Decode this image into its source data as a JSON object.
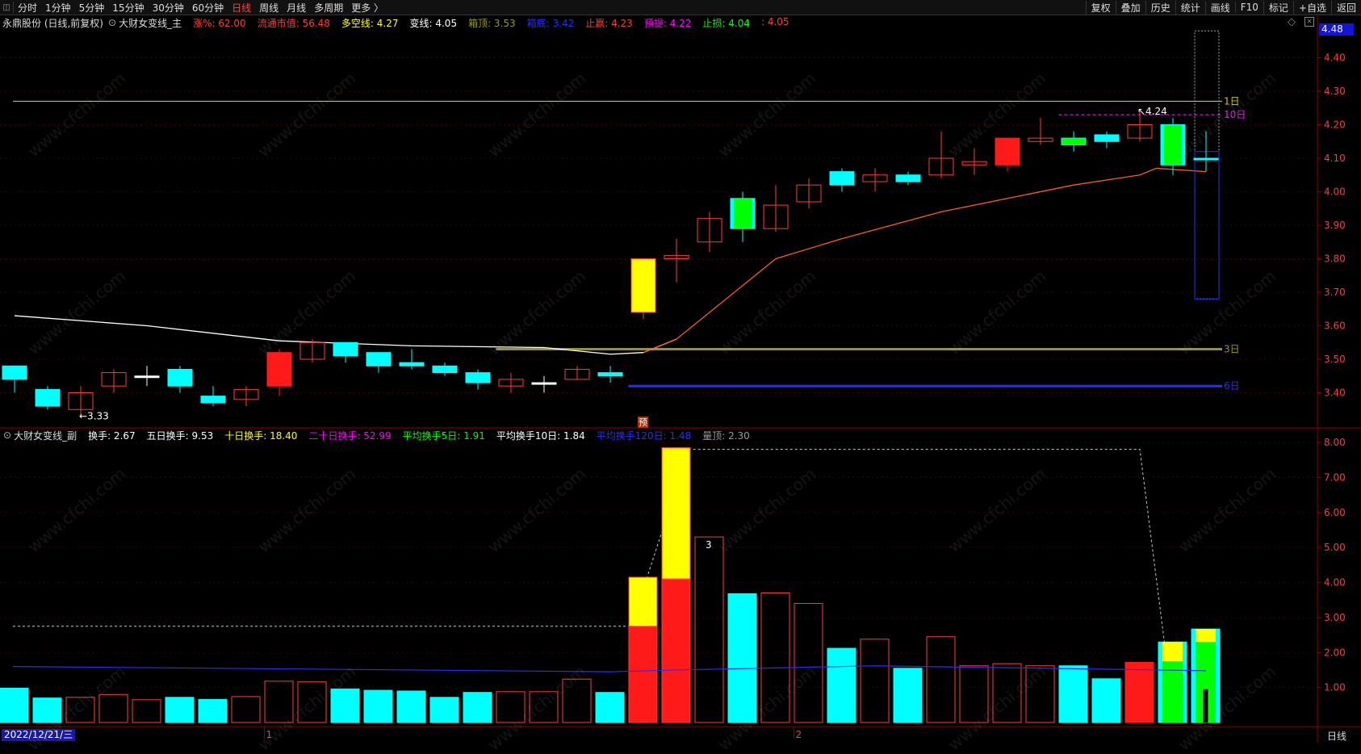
{
  "toolbar": {
    "periods": [
      "分时",
      "1分钟",
      "5分钟",
      "15分钟",
      "30分钟",
      "60分钟",
      "日线",
      "周线",
      "月线",
      "多周期",
      "更多 〉"
    ],
    "active_period": "日线",
    "right_items": [
      "复权",
      "叠加",
      "历史",
      "统计",
      "画线",
      "F10",
      "标记",
      "+自选",
      "返回"
    ]
  },
  "main_info": {
    "stock": "永鼎股份 (日线,前复权)",
    "indicator": "大财女变线_主",
    "fields": [
      {
        "label": "涨%: 62.00",
        "color": "#ff3b3b"
      },
      {
        "label": "流通市值: 56.48",
        "color": "#ff3b3b"
      },
      {
        "label": "多空线: 4.27",
        "color": "#ffff00"
      },
      {
        "label": "变线: 4.05",
        "color": "#ffffff"
      },
      {
        "label": "箱顶: 3.53",
        "color": "#9a9a00"
      },
      {
        "label": "箱底: 3.42",
        "color": "#2b2bff"
      },
      {
        "label": "止赢: 4.23",
        "color": "#ff3b3b"
      },
      {
        "label": "预提: 4.22",
        "color": "#ff00ff"
      },
      {
        "label": "止损: 4.04",
        "color": "#00ff00"
      },
      {
        "label": ": 4.05",
        "color": "#ff3b3b"
      }
    ]
  },
  "sub_info": {
    "indicator": "大财女变线_副",
    "fields": [
      {
        "label": "换手: 2.67",
        "color": "#ffffff"
      },
      {
        "label": "五日换手: 9.53",
        "color": "#ffffff"
      },
      {
        "label": "十日换手: 18.40",
        "color": "#ffff00"
      },
      {
        "label": "二十日换手: 52.99",
        "color": "#ff00ff"
      },
      {
        "label": "平均换手5日: 1.91",
        "color": "#00ff00"
      },
      {
        "label": "平均换手10日: 1.84",
        "color": "#ffffff"
      },
      {
        "label": "平均换手120日: 1.48",
        "color": "#2b2bff"
      },
      {
        "label": "量顶: 2.30",
        "color": "#999999"
      }
    ]
  },
  "current_price": "4.48",
  "price_axis": [
    "4.40",
    "4.30",
    "4.20",
    "4.10",
    "4.00",
    "3.90",
    "3.80",
    "3.70",
    "3.60",
    "3.50",
    "3.40"
  ],
  "volume_axis": [
    "8.00",
    "7.00",
    "6.00",
    "5.00",
    "4.00",
    "3.00",
    "2.00",
    "1.00"
  ],
  "annotations": {
    "low_label": "←3.33",
    "high_label": "↖4.24",
    "line_1d": "1日",
    "line_10d": "10日",
    "line_3d": "3日",
    "line_6d": "6日",
    "pre_mark": "预",
    "vol_mark": "3"
  },
  "date_start": "2022/12/21/三",
  "month_marks": [
    "1",
    "2"
  ],
  "period_label": "日线",
  "watermark": "www.cfchi.com",
  "colors": {
    "up": "#ff3b3b",
    "down": "#00ffff",
    "yellow": "#ffff00",
    "green": "#00ff00"
  },
  "chart_data": {
    "type": "candlestick",
    "candles": [
      {
        "o": 3.48,
        "c": 3.44,
        "h": 3.48,
        "l": 3.4,
        "col": "down"
      },
      {
        "o": 3.41,
        "c": 3.36,
        "h": 3.42,
        "l": 3.35,
        "col": "down"
      },
      {
        "o": 3.35,
        "c": 3.4,
        "h": 3.42,
        "l": 3.33,
        "col": "up"
      },
      {
        "o": 3.42,
        "c": 3.46,
        "h": 3.47,
        "l": 3.4,
        "col": "up"
      },
      {
        "o": 3.45,
        "c": 3.45,
        "h": 3.48,
        "l": 3.42,
        "col": "doji"
      },
      {
        "o": 3.47,
        "c": 3.42,
        "h": 3.48,
        "l": 3.4,
        "col": "down"
      },
      {
        "o": 3.39,
        "c": 3.37,
        "h": 3.42,
        "l": 3.36,
        "col": "down"
      },
      {
        "o": 3.38,
        "c": 3.41,
        "h": 3.42,
        "l": 3.36,
        "col": "up"
      },
      {
        "o": 3.42,
        "c": 3.52,
        "h": 3.53,
        "l": 3.39,
        "col": "bigred"
      },
      {
        "o": 3.5,
        "c": 3.55,
        "h": 3.56,
        "l": 3.49,
        "col": "up"
      },
      {
        "o": 3.55,
        "c": 3.51,
        "h": 3.55,
        "l": 3.49,
        "col": "down"
      },
      {
        "o": 3.52,
        "c": 3.48,
        "h": 3.52,
        "l": 3.46,
        "col": "down"
      },
      {
        "o": 3.49,
        "c": 3.48,
        "h": 3.53,
        "l": 3.47,
        "col": "down"
      },
      {
        "o": 3.48,
        "c": 3.46,
        "h": 3.49,
        "l": 3.45,
        "col": "down"
      },
      {
        "o": 3.46,
        "c": 3.43,
        "h": 3.47,
        "l": 3.41,
        "col": "down"
      },
      {
        "o": 3.42,
        "c": 3.44,
        "h": 3.46,
        "l": 3.4,
        "col": "up"
      },
      {
        "o": 3.43,
        "c": 3.43,
        "h": 3.45,
        "l": 3.4,
        "col": "doji"
      },
      {
        "o": 3.44,
        "c": 3.47,
        "h": 3.48,
        "l": 3.44,
        "col": "up"
      },
      {
        "o": 3.46,
        "c": 3.45,
        "h": 3.48,
        "l": 3.43,
        "col": "down"
      },
      {
        "o": 3.64,
        "c": 3.8,
        "h": 3.8,
        "l": 3.62,
        "col": "yellow"
      },
      {
        "o": 3.8,
        "c": 3.81,
        "h": 3.86,
        "l": 3.73,
        "col": "up"
      },
      {
        "o": 3.85,
        "c": 3.92,
        "h": 3.94,
        "l": 3.82,
        "col": "up"
      },
      {
        "o": 3.98,
        "c": 3.89,
        "h": 4.0,
        "l": 3.85,
        "col": "greencyan"
      },
      {
        "o": 3.89,
        "c": 3.96,
        "h": 4.02,
        "l": 3.88,
        "col": "up"
      },
      {
        "o": 3.97,
        "c": 4.02,
        "h": 4.04,
        "l": 3.95,
        "col": "up"
      },
      {
        "o": 4.06,
        "c": 4.02,
        "h": 4.07,
        "l": 4.0,
        "col": "down"
      },
      {
        "o": 4.03,
        "c": 4.05,
        "h": 4.07,
        "l": 4.0,
        "col": "up"
      },
      {
        "o": 4.05,
        "c": 4.03,
        "h": 4.06,
        "l": 4.02,
        "col": "down"
      },
      {
        "o": 4.05,
        "c": 4.1,
        "h": 4.18,
        "l": 4.04,
        "col": "up"
      },
      {
        "o": 4.08,
        "c": 4.09,
        "h": 4.13,
        "l": 4.05,
        "col": "up"
      },
      {
        "o": 4.08,
        "c": 4.16,
        "h": 4.16,
        "l": 4.06,
        "col": "bigred"
      },
      {
        "o": 4.15,
        "c": 4.16,
        "h": 4.22,
        "l": 4.14,
        "col": "up"
      },
      {
        "o": 4.16,
        "c": 4.14,
        "h": 4.18,
        "l": 4.12,
        "col": "greencyan2"
      },
      {
        "o": 4.17,
        "c": 4.15,
        "h": 4.18,
        "l": 4.13,
        "col": "down"
      },
      {
        "o": 4.16,
        "c": 4.2,
        "h": 4.24,
        "l": 4.15,
        "col": "up"
      },
      {
        "o": 4.2,
        "c": 4.08,
        "h": 4.22,
        "l": 4.05,
        "col": "greencyan"
      },
      {
        "o": 4.1,
        "c": 4.1,
        "h": 4.18,
        "l": 4.06,
        "col": "down"
      }
    ],
    "volumes": [
      {
        "v": 0.98,
        "col": "down"
      },
      {
        "v": 0.7,
        "col": "down"
      },
      {
        "v": 0.72,
        "col": "up"
      },
      {
        "v": 0.8,
        "col": "up"
      },
      {
        "v": 0.65,
        "col": "up"
      },
      {
        "v": 0.72,
        "col": "down"
      },
      {
        "v": 0.66,
        "col": "down"
      },
      {
        "v": 0.74,
        "col": "up"
      },
      {
        "v": 1.18,
        "col": "up"
      },
      {
        "v": 1.16,
        "col": "up"
      },
      {
        "v": 0.96,
        "col": "down"
      },
      {
        "v": 0.92,
        "col": "down"
      },
      {
        "v": 0.9,
        "col": "down"
      },
      {
        "v": 0.72,
        "col": "down"
      },
      {
        "v": 0.86,
        "col": "down"
      },
      {
        "v": 0.88,
        "col": "up"
      },
      {
        "v": 0.88,
        "col": "up"
      },
      {
        "v": 1.24,
        "col": "up"
      },
      {
        "v": 0.86,
        "col": "down"
      },
      {
        "v": 4.15,
        "col": "yelred",
        "split": 2.75
      },
      {
        "v": 7.85,
        "col": "yelred",
        "split": 4.1
      },
      {
        "v": 5.3,
        "col": "up"
      },
      {
        "v": 3.68,
        "col": "down"
      },
      {
        "v": 3.7,
        "col": "up"
      },
      {
        "v": 3.4,
        "col": "up"
      },
      {
        "v": 2.12,
        "col": "down"
      },
      {
        "v": 2.38,
        "col": "up"
      },
      {
        "v": 1.55,
        "col": "down"
      },
      {
        "v": 2.45,
        "col": "up"
      },
      {
        "v": 1.62,
        "col": "up"
      },
      {
        "v": 1.68,
        "col": "up"
      },
      {
        "v": 1.62,
        "col": "up"
      },
      {
        "v": 1.62,
        "col": "down"
      },
      {
        "v": 1.25,
        "col": "down"
      },
      {
        "v": 1.72,
        "col": "red"
      },
      {
        "v": 2.3,
        "col": "yelgreen",
        "split": 1.75
      },
      {
        "v": 2.67,
        "col": "yelgreen2",
        "split": 2.3
      }
    ],
    "ma_white": [
      [
        0,
        3.63
      ],
      [
        4,
        3.6
      ],
      [
        8,
        3.555
      ],
      [
        12,
        3.54
      ],
      [
        16,
        3.535
      ],
      [
        18,
        3.515
      ],
      [
        19,
        3.52
      ],
      [
        20,
        3.56
      ]
    ],
    "ma_red": [
      [
        19,
        3.52
      ],
      [
        20,
        3.56
      ],
      [
        22,
        3.72
      ],
      [
        23,
        3.8
      ],
      [
        25,
        3.86
      ],
      [
        28,
        3.94
      ],
      [
        30,
        3.98
      ],
      [
        32,
        4.02
      ],
      [
        34,
        4.05
      ],
      [
        34.5,
        4.07
      ],
      [
        36,
        4.06
      ]
    ],
    "hlines": [
      {
        "y": 4.27,
        "from": 0,
        "to": 36,
        "color": "#c8c800",
        "label": "1日"
      },
      {
        "y": 4.23,
        "from": 32,
        "to": 36,
        "color": "#ff00ff",
        "label": "10日",
        "dashed": true
      },
      {
        "y": 3.53,
        "from": 15,
        "to": 36,
        "color": "#9a9a00",
        "label": "3日",
        "thick": true
      },
      {
        "y": 3.42,
        "from": 19,
        "to": 36,
        "color": "#2b2bff",
        "label": "6日",
        "thick": true
      }
    ],
    "vol_ma_blue": 1.6,
    "vol_dashed_top": 7.8,
    "vol_dashed_base": 2.75,
    "price_ylim": [
      3.3,
      4.5
    ],
    "vol_ylim": [
      0,
      8
    ]
  }
}
